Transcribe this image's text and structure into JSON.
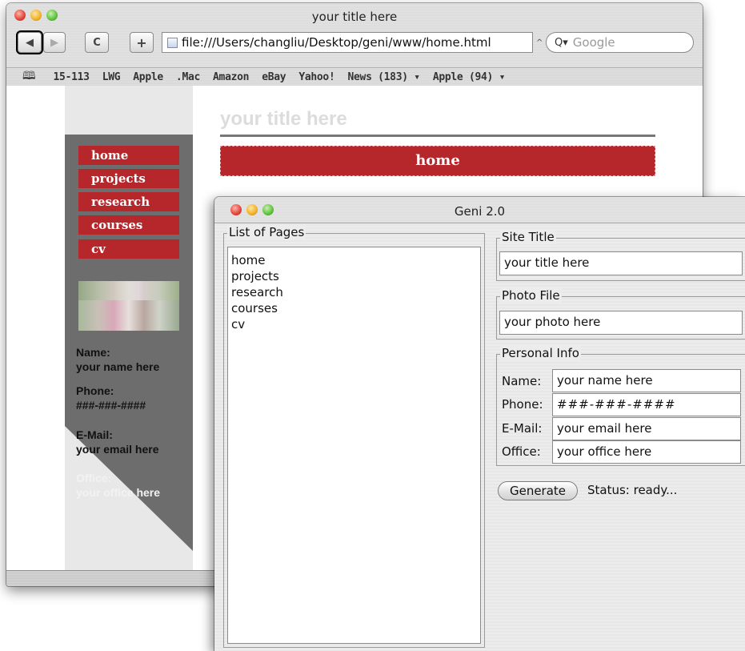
{
  "browser": {
    "title": "your title here",
    "url": "file:///Users/changliu/Desktop/geni/www/home.html",
    "snapback": "^",
    "search_placeholder": "Google",
    "nav": {
      "back": "◀",
      "forward": "▶",
      "reload": "C",
      "add": "+"
    },
    "bookmarks": [
      "15-113",
      "LWG",
      "Apple",
      ".Mac",
      "Amazon",
      "eBay",
      "Yahoo!",
      "News (183) ▾",
      "Apple (94) ▾"
    ],
    "book_icon": "📖"
  },
  "page": {
    "title": "your title here",
    "nav": [
      "home",
      "projects",
      "research",
      "courses",
      "cv"
    ],
    "banner": "home",
    "info": [
      {
        "label": "Name:",
        "value": "your name here"
      },
      {
        "label": "Phone:",
        "value": "###-###-####"
      },
      {
        "label": "E-Mail:",
        "value": "your email here"
      },
      {
        "label": "Office:",
        "value": "your office here"
      }
    ]
  },
  "geni": {
    "title": "Geni 2.0",
    "list_legend": "List of Pages",
    "pages": [
      "home",
      "projects",
      "research",
      "courses",
      "cv"
    ],
    "site_title_legend": "Site Title",
    "site_title": "your title here",
    "photo_legend": "Photo File",
    "photo_file": "your photo here",
    "personal_legend": "Personal Info",
    "fields": [
      {
        "label": "Name:",
        "value": "your name here"
      },
      {
        "label": "Phone:",
        "value": "###-###-####"
      },
      {
        "label": "E-Mail:",
        "value": "your email here"
      },
      {
        "label": "Office:",
        "value": "your office here"
      }
    ],
    "generate_label": "Generate",
    "status": "Status: ready..."
  },
  "colors": {
    "accent_red": "#b5272a",
    "sidebar_gray": "#6d6d6d"
  }
}
